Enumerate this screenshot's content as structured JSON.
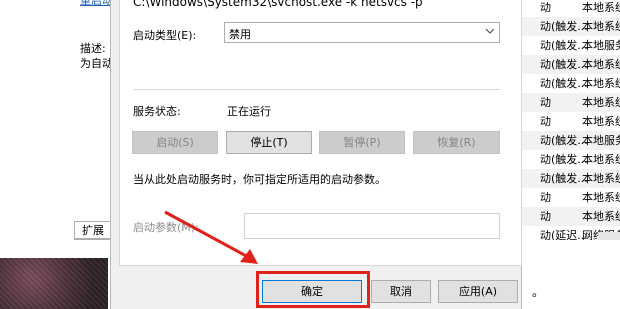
{
  "background": {
    "link_text": "重启动",
    "description_label": "描述:",
    "description_text": "为自动",
    "tab_label": "扩展",
    "service_rows": [
      {
        "startup": "动",
        "logon": "本地系统"
      },
      {
        "startup": "动(触发...",
        "logon": "本地系统"
      },
      {
        "startup": "动(触发...",
        "logon": "本地服务"
      },
      {
        "startup": "动(触发...",
        "logon": "本地系统"
      },
      {
        "startup": "动(触发...",
        "logon": "本地系统"
      },
      {
        "startup": "动",
        "logon": "本地系统"
      },
      {
        "startup": "动",
        "logon": "本地系统"
      },
      {
        "startup": "动(触发...",
        "logon": "本地服务"
      },
      {
        "startup": "动(触发...",
        "logon": "本地系统"
      },
      {
        "startup": "动(触发...",
        "logon": "本地系统"
      },
      {
        "startup": "动",
        "logon": "本地系统"
      },
      {
        "startup": "动",
        "logon": "本地系统"
      },
      {
        "startup": "动(延迟...",
        "logon": "网络服务"
      }
    ],
    "bottom_text": "。"
  },
  "dialog": {
    "exe_path": "C:\\Windows\\System32\\svchost.exe -k netsvcs -p",
    "startup_type_label": "启动类型(E):",
    "startup_type_value": "禁用",
    "status_label": "服务状态:",
    "status_value": "正在运行",
    "buttons": {
      "start": "启动(S)",
      "stop": "停止(T)",
      "pause": "暂停(P)",
      "resume": "恢复(R)"
    },
    "hint": "当从此处启动服务时，你可指定所适用的启动参数。",
    "param_label": "启动参数(M):",
    "param_value": "",
    "ok": "确定",
    "cancel": "取消",
    "apply": "应用(A)"
  },
  "colors": {
    "highlight": "#e0201b",
    "link": "#1a5fb4"
  }
}
